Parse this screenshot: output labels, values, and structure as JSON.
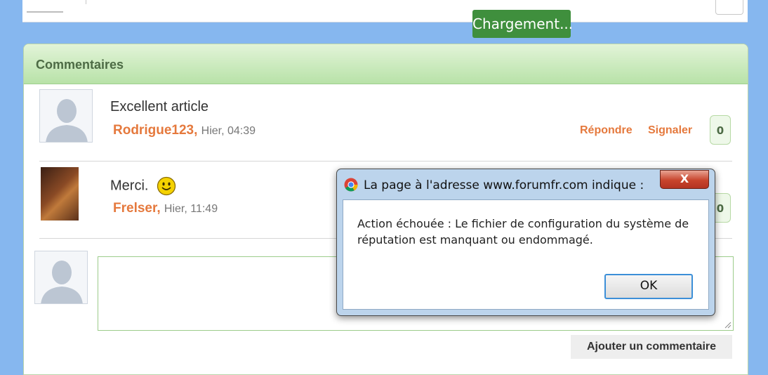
{
  "loading_label": "Chargement...",
  "panel": {
    "title": "Commentaires"
  },
  "comments": [
    {
      "text": "Excellent article",
      "author": "Rodrigue123",
      "separator": ",",
      "time": "Hier, 04:39",
      "reply_label": "Répondre",
      "report_label": "Signaler",
      "count": "0"
    },
    {
      "text": "Merci.",
      "author": "Frelser",
      "separator": ",",
      "time": "Hier, 11:49",
      "count": "0"
    }
  ],
  "composer": {
    "submit_label": "Ajouter un commentaire"
  },
  "dialog": {
    "title": "La page à l'adresse www.forumfr.com indique :",
    "close_glyph": "X",
    "message": "Action échouée : Le fichier de configuration du système de réputation est manquant ou endommagé.",
    "ok_label": "OK"
  },
  "colors": {
    "accent": "#e5793d",
    "header_green": "#b8e2a8",
    "loading_green": "#3f8f3d",
    "page_blue": "#86b7ef"
  }
}
